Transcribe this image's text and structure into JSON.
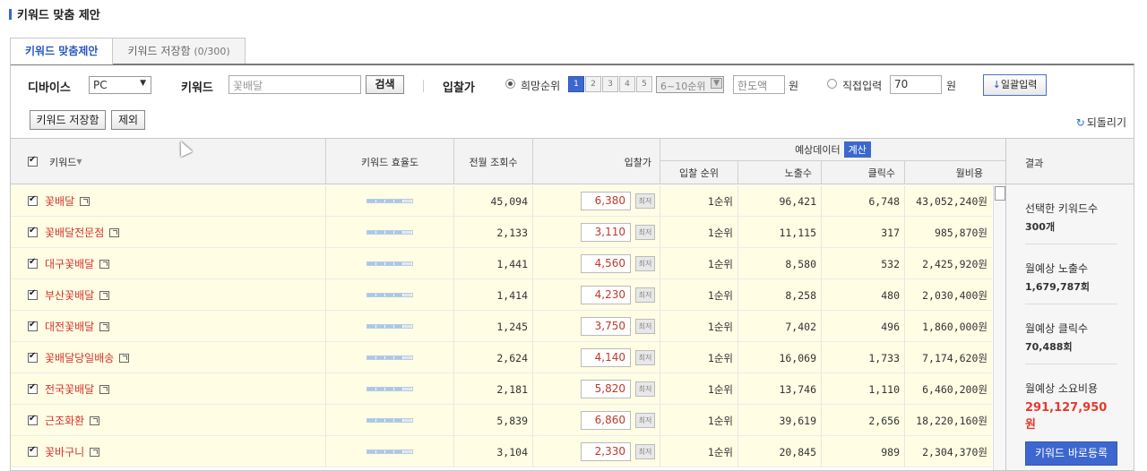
{
  "page_title": "키워드 맞춤 제안",
  "tabs": [
    {
      "label": "키워드 맞춤제안",
      "sub": "",
      "active": true
    },
    {
      "label": "키워드 저장함",
      "sub": "(0/300)",
      "active": false
    }
  ],
  "filters": {
    "device_label": "디바이스",
    "device_value": "PC",
    "keyword_label": "키워드",
    "keyword_placeholder": "꽃배달",
    "search_button": "검색",
    "bid_label": "입찰가",
    "desired_rank_label": "희망순위",
    "rank_numbers": [
      "1",
      "2",
      "3",
      "4",
      "5"
    ],
    "rank_range_value": "6~10순위",
    "limit_placeholder": "한도액",
    "won": "원",
    "direct_input_label": "직접입력",
    "direct_input_value": "70",
    "bulk_input_button": "일괄입력"
  },
  "toolbar": {
    "save_button": "키워드 저장함",
    "exclude_button": "제외",
    "refresh_label": "되돌리기"
  },
  "table": {
    "headers": {
      "keyword": "키워드",
      "efficiency": "키워드 효율도",
      "monthly_views": "전월 조회수",
      "bid": "입찰가",
      "forecast_group": "예상데이터",
      "calc_button": "계산",
      "rank": "입찰 순위",
      "impressions": "노출수",
      "clicks": "클릭수",
      "monthly_cost": "월비용"
    },
    "min_label": "최저",
    "rows": [
      {
        "keyword": "꽃배달",
        "views": "45,094",
        "bid": "6,380",
        "rank": "1순위",
        "impressions": "96,421",
        "clicks": "6,748",
        "cost": "43,052,240원"
      },
      {
        "keyword": "꽃배달전문점",
        "views": "2,133",
        "bid": "3,110",
        "rank": "1순위",
        "impressions": "11,115",
        "clicks": "317",
        "cost": "985,870원"
      },
      {
        "keyword": "대구꽃배달",
        "views": "1,441",
        "bid": "4,560",
        "rank": "1순위",
        "impressions": "8,580",
        "clicks": "532",
        "cost": "2,425,920원"
      },
      {
        "keyword": "부산꽃배달",
        "views": "1,414",
        "bid": "4,230",
        "rank": "1순위",
        "impressions": "8,258",
        "clicks": "480",
        "cost": "2,030,400원"
      },
      {
        "keyword": "대전꽃배달",
        "views": "1,245",
        "bid": "3,750",
        "rank": "1순위",
        "impressions": "7,402",
        "clicks": "496",
        "cost": "1,860,000원"
      },
      {
        "keyword": "꽃배달당일배송",
        "views": "2,624",
        "bid": "4,140",
        "rank": "1순위",
        "impressions": "16,069",
        "clicks": "1,733",
        "cost": "7,174,620원"
      },
      {
        "keyword": "전국꽃배달",
        "views": "2,181",
        "bid": "5,820",
        "rank": "1순위",
        "impressions": "13,746",
        "clicks": "1,110",
        "cost": "6,460,200원"
      },
      {
        "keyword": "근조화환",
        "views": "5,839",
        "bid": "6,860",
        "rank": "1순위",
        "impressions": "39,619",
        "clicks": "2,656",
        "cost": "18,220,160원"
      },
      {
        "keyword": "꽃바구니",
        "views": "3,104",
        "bid": "2,330",
        "rank": "1순위",
        "impressions": "20,845",
        "clicks": "989",
        "cost": "2,304,370원"
      }
    ]
  },
  "result": {
    "header": "결과",
    "selected_label": "선택한 키워드수",
    "selected_value": "300개",
    "impressions_label": "월예상 노출수",
    "impressions_value": "1,679,787회",
    "clicks_label": "월예상 클릭수",
    "clicks_value": "70,488회",
    "cost_label": "월예상 소요비용",
    "cost_value": "291,127,950원",
    "register_button": "키워드 바로등록"
  },
  "colors": {
    "accent": "#3d67cf",
    "keyword_red": "#d1352c",
    "row_highlight": "#fffde4",
    "total_red": "#e63a2f"
  }
}
